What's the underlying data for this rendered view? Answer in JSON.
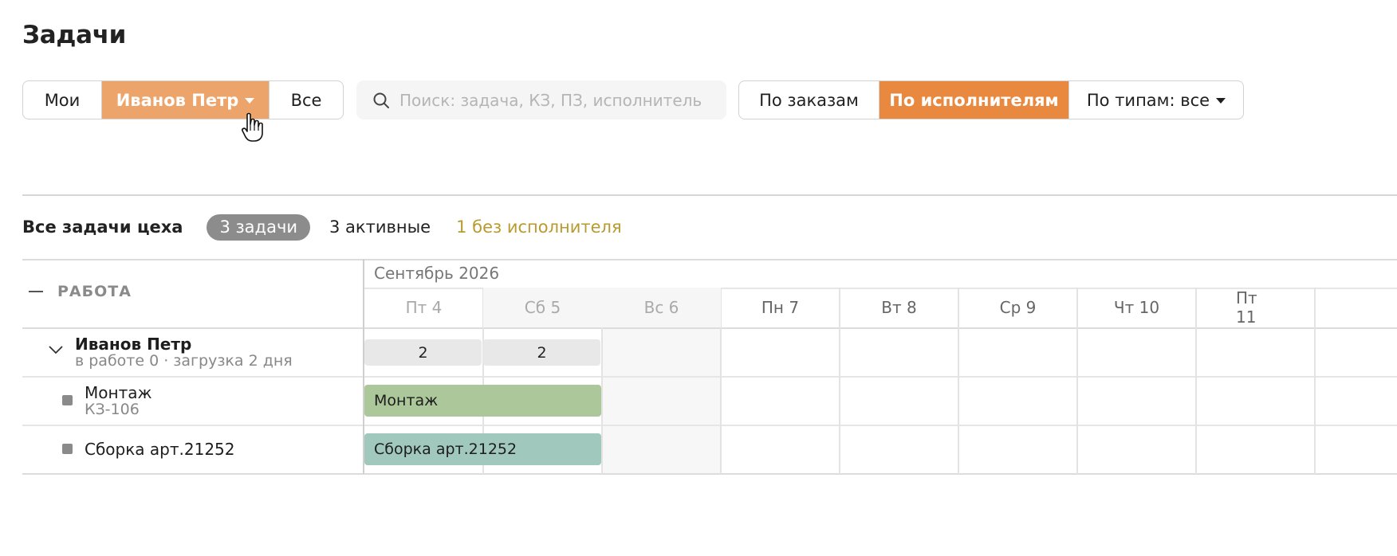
{
  "page": {
    "title": "Задачи"
  },
  "filters": {
    "mine": "Мои",
    "person": "Иванов Петр",
    "all": "Все"
  },
  "search": {
    "placeholder": "Поиск: задача, КЗ, ПЗ, исполнитель"
  },
  "grouping": {
    "by_orders": "По заказам",
    "by_executors": "По исполнителям",
    "by_types": "По типам: все"
  },
  "summary": {
    "label": "Все задачи цеха",
    "count_pill": "3 задачи",
    "active": "3 активные",
    "unassigned": "1 без исполнителя"
  },
  "colors": {
    "accent": "#e8893f",
    "accent_light": "#eda46a",
    "warning_text": "#b99a2f",
    "bar_montage": "#acc79a",
    "bar_assembly": "#a0c8bd"
  },
  "timeline": {
    "section": "РАБОТА",
    "month": "Сентябрь 2026",
    "days": [
      "Пт 4",
      "Сб 5",
      "Вс 6",
      "Пн 7",
      "Вт 8",
      "Ср 9",
      "Чт 10",
      "Пт 11"
    ]
  },
  "group": {
    "name": "Иванов Петр",
    "sub": "в работе 0 · загрузка 2 дня",
    "loads": [
      "2",
      "2"
    ]
  },
  "tasks": [
    {
      "name": "Монтаж",
      "sub": "КЗ-106",
      "bar": "Монтаж"
    },
    {
      "name": "Сборка арт.21252",
      "sub": "",
      "bar": "Сборка арт.21252"
    }
  ]
}
